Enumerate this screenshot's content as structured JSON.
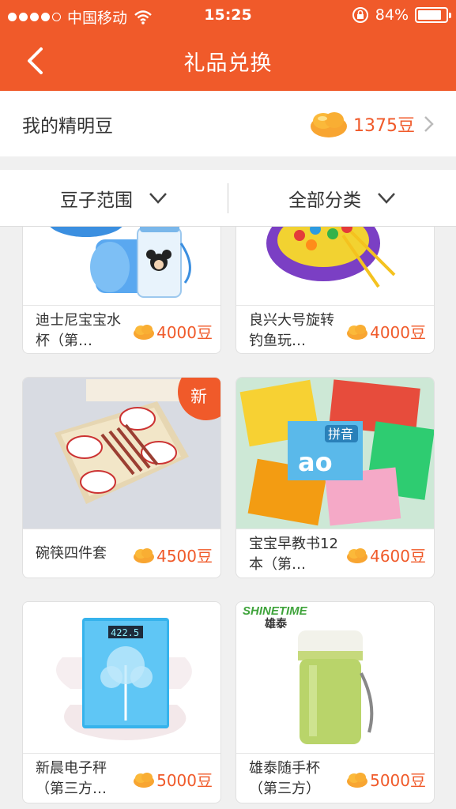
{
  "status_bar": {
    "carrier": "中国移动",
    "time": "15:25",
    "battery": "84%",
    "battery_level": 0.84
  },
  "nav": {
    "title": "礼品兑换",
    "back_icon": "chevron-left-icon"
  },
  "beans": {
    "label": "我的精明豆",
    "amount": "1375豆",
    "icon": "bean-icon"
  },
  "filters": [
    {
      "label": "豆子范围",
      "icon": "chevron-down-icon"
    },
    {
      "label": "全部分类",
      "icon": "chevron-down-icon"
    }
  ],
  "products": [
    {
      "name": "迪士尼宝宝水杯（第…",
      "price": "4000豆"
    },
    {
      "name": "良兴大号旋转钓鱼玩…",
      "price": "4000豆"
    },
    {
      "name": "碗筷四件套",
      "price": "4500豆",
      "badge": "新"
    },
    {
      "name": "宝宝早教书12本（第…",
      "price": "4600豆"
    },
    {
      "name": "新晨电子秤（第三方…",
      "price": "5000豆"
    },
    {
      "name": "雄泰随手杯（第三方）",
      "price": "5000豆"
    }
  ],
  "image_text": {
    "scale_display": "422.5",
    "thermos_brand_en": "SHINETIME",
    "thermos_brand_cn": "雄泰",
    "book_cover_text": "拼音",
    "book_letters": "ao"
  },
  "colors": {
    "accent": "#f05a2a",
    "background": "#f0f0f0"
  }
}
